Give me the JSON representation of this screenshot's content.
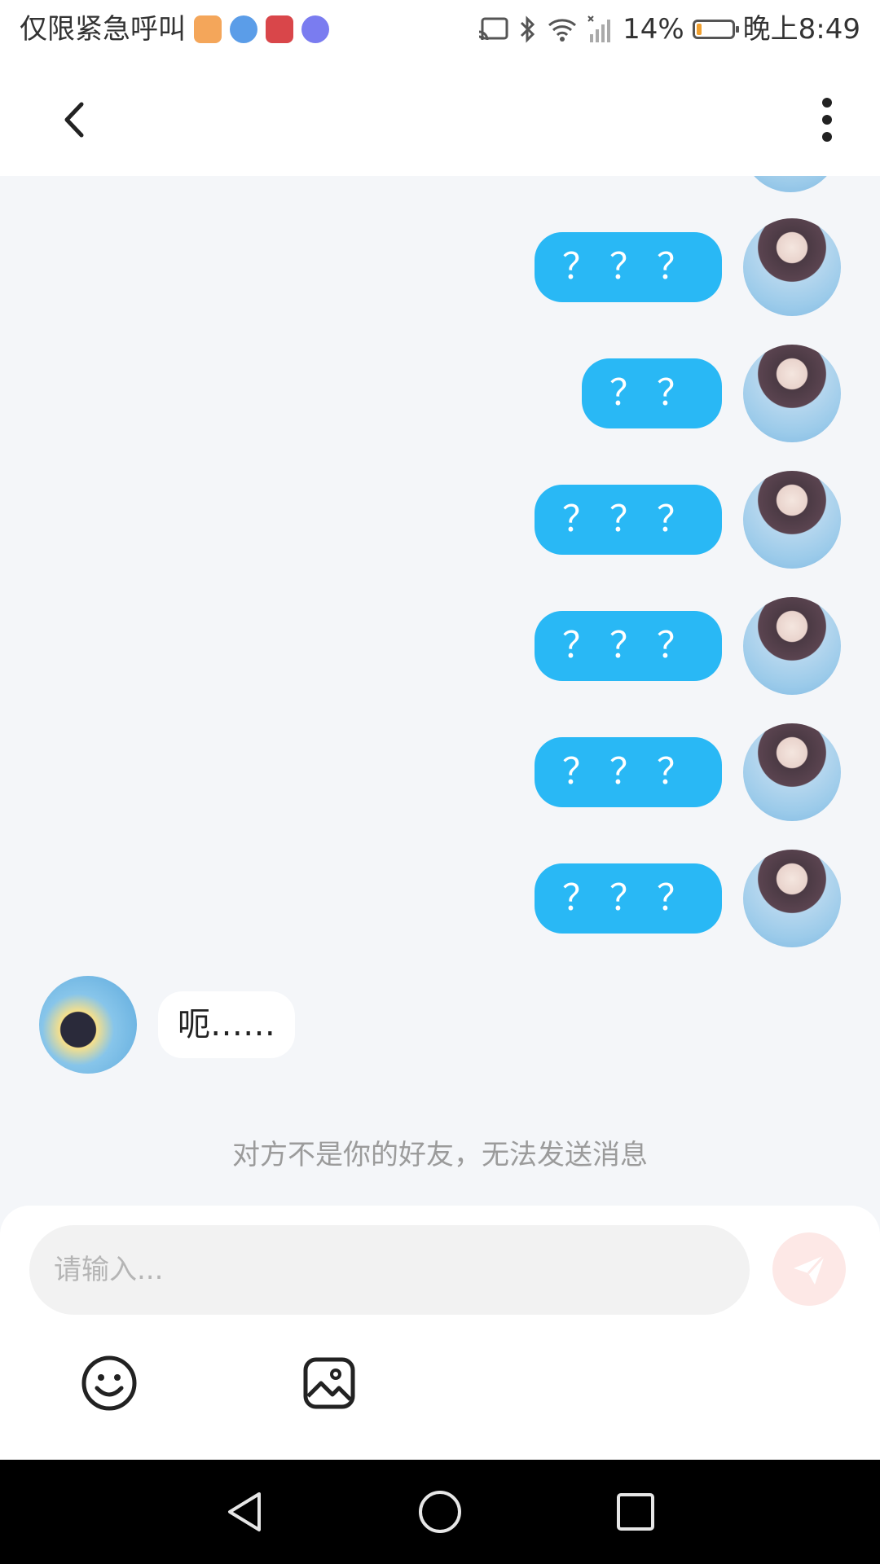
{
  "status_bar": {
    "carrier_text": "仅限紧急呼叫",
    "battery_percent": "14%",
    "battery_level": 0.14,
    "time": "晚上8:49"
  },
  "header": {
    "back_icon": "chevron-left-icon",
    "more_icon": "more-vertical-icon"
  },
  "messages": [
    {
      "direction": "out",
      "text": "？？？"
    },
    {
      "direction": "out",
      "text": "？？"
    },
    {
      "direction": "out",
      "text": "？？？"
    },
    {
      "direction": "out",
      "text": "？？？"
    },
    {
      "direction": "out",
      "text": "？？？"
    },
    {
      "direction": "out",
      "text": "？？？"
    },
    {
      "direction": "in",
      "text": "呃……"
    }
  ],
  "notice": "对方不是你的好友，无法发送消息",
  "composer": {
    "placeholder": "请输入...",
    "send_icon": "paper-plane-icon",
    "emoji_icon": "smiley-icon",
    "image_icon": "image-icon"
  },
  "colors": {
    "outgoing_bubble": "#29b8f5",
    "send_button": "#fde8e6",
    "chat_background": "#f4f6f9"
  }
}
